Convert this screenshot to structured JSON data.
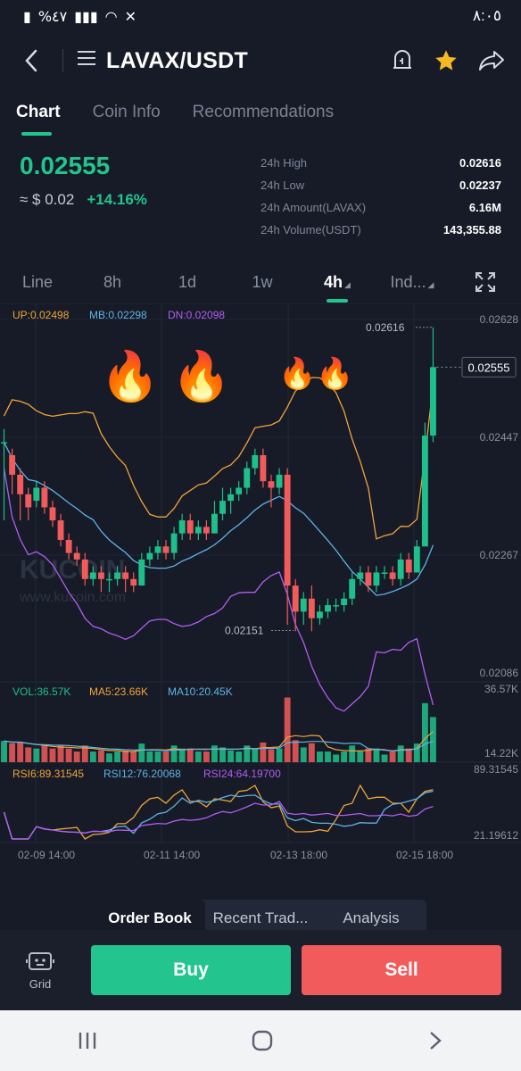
{
  "status_bar": {
    "left": "%٤٧",
    "time": "٨:٠٥"
  },
  "nav": {
    "pair": "LAVAX/USDT"
  },
  "tabs": [
    {
      "label": "Chart",
      "active": true
    },
    {
      "label": "Coin Info",
      "active": false
    },
    {
      "label": "Recommendations",
      "active": false
    }
  ],
  "price": {
    "last": "0.02555",
    "fiat": "≈ $ 0.02",
    "change": "+14.16%"
  },
  "stats": [
    {
      "label": "24h High",
      "value": "0.02616"
    },
    {
      "label": "24h Low",
      "value": "0.02237"
    },
    {
      "label": "24h Amount(LAVAX)",
      "value": "6.16M"
    },
    {
      "label": "24h Volume(USDT)",
      "value": "143,355.88"
    }
  ],
  "intervals": [
    {
      "label": "Line",
      "active": false,
      "dropdown": false
    },
    {
      "label": "8h",
      "active": false,
      "dropdown": false
    },
    {
      "label": "1d",
      "active": false,
      "dropdown": false
    },
    {
      "label": "1w",
      "active": false,
      "dropdown": false
    },
    {
      "label": "4h",
      "active": true,
      "dropdown": true
    },
    {
      "label": "Ind...",
      "active": false,
      "dropdown": true
    }
  ],
  "chart_data": {
    "type": "candlestick",
    "boll": {
      "up": "UP:0.02498",
      "mb": "MB:0.02298",
      "dn": "DN:0.02098"
    },
    "y_ticks": [
      "0.02628",
      "0.02447",
      "0.02267",
      "0.02086"
    ],
    "ylim": [
      0.02086,
      0.02628
    ],
    "current_price_label": "0.02555",
    "current_price": 0.02555,
    "high_marker": "0.02616",
    "high_value": 0.02616,
    "low_marker": "0.02151",
    "low_value": 0.02151,
    "watermark": {
      "brand": "KUCOIN",
      "url": "www.kucoin.com"
    },
    "candles": [
      [
        0.0244,
        0.0244,
        0.0246,
        0.0232
      ],
      [
        0.0242,
        0.0239,
        0.0243,
        0.0236
      ],
      [
        0.0239,
        0.0236,
        0.024,
        0.0232
      ],
      [
        0.0236,
        0.0234,
        0.0237,
        0.0232
      ],
      [
        0.0235,
        0.0237,
        0.0238,
        0.0234
      ],
      [
        0.0237,
        0.0234,
        0.0238,
        0.0233
      ],
      [
        0.0234,
        0.0232,
        0.0235,
        0.0231
      ],
      [
        0.0232,
        0.0229,
        0.0233,
        0.0228
      ],
      [
        0.0229,
        0.0227,
        0.023,
        0.0226
      ],
      [
        0.0227,
        0.0226,
        0.0228,
        0.0225
      ],
      [
        0.0226,
        0.0223,
        0.0227,
        0.0222
      ],
      [
        0.0223,
        0.0224,
        0.0225,
        0.0222
      ],
      [
        0.0224,
        0.0223,
        0.0225,
        0.0221
      ],
      [
        0.0223,
        0.0223,
        0.0224,
        0.0221
      ],
      [
        0.0223,
        0.0224,
        0.0225,
        0.0222
      ],
      [
        0.0224,
        0.0223,
        0.0225,
        0.0221
      ],
      [
        0.0223,
        0.0222,
        0.0224,
        0.0221
      ],
      [
        0.0222,
        0.0226,
        0.0227,
        0.0222
      ],
      [
        0.0226,
        0.0227,
        0.0228,
        0.0225
      ],
      [
        0.0227,
        0.0228,
        0.0229,
        0.0226
      ],
      [
        0.0228,
        0.0227,
        0.0229,
        0.0226
      ],
      [
        0.0227,
        0.023,
        0.0231,
        0.0226
      ],
      [
        0.023,
        0.0232,
        0.0233,
        0.0229
      ],
      [
        0.0232,
        0.023,
        0.0233,
        0.0229
      ],
      [
        0.023,
        0.0231,
        0.0232,
        0.0229
      ],
      [
        0.0231,
        0.023,
        0.0232,
        0.0229
      ],
      [
        0.023,
        0.0233,
        0.0235,
        0.023
      ],
      [
        0.0233,
        0.0235,
        0.0237,
        0.0232
      ],
      [
        0.0235,
        0.0236,
        0.0237,
        0.0233
      ],
      [
        0.0236,
        0.0237,
        0.0238,
        0.0235
      ],
      [
        0.0237,
        0.024,
        0.0241,
        0.0236
      ],
      [
        0.024,
        0.0242,
        0.0243,
        0.0239
      ],
      [
        0.0242,
        0.0238,
        0.0243,
        0.0237
      ],
      [
        0.0238,
        0.0237,
        0.0239,
        0.0234
      ],
      [
        0.0237,
        0.0239,
        0.024,
        0.0236
      ],
      [
        0.0239,
        0.0222,
        0.024,
        0.0216
      ],
      [
        0.0222,
        0.0218,
        0.0223,
        0.0215
      ],
      [
        0.0218,
        0.022,
        0.0221,
        0.0216
      ],
      [
        0.022,
        0.0217,
        0.0222,
        0.0215
      ],
      [
        0.0217,
        0.0218,
        0.0219,
        0.0216
      ],
      [
        0.0218,
        0.0219,
        0.022,
        0.0217
      ],
      [
        0.0219,
        0.0219,
        0.022,
        0.0218
      ],
      [
        0.0219,
        0.022,
        0.0221,
        0.0218
      ],
      [
        0.022,
        0.0223,
        0.0224,
        0.0219
      ],
      [
        0.0223,
        0.0224,
        0.0225,
        0.0222
      ],
      [
        0.0224,
        0.0222,
        0.0225,
        0.0221
      ],
      [
        0.0222,
        0.0224,
        0.0225,
        0.0221
      ],
      [
        0.0224,
        0.0224,
        0.0225,
        0.0223
      ],
      [
        0.0224,
        0.0223,
        0.0225,
        0.0222
      ],
      [
        0.0223,
        0.0226,
        0.0227,
        0.0222
      ],
      [
        0.0226,
        0.0224,
        0.0227,
        0.0223
      ],
      [
        0.0224,
        0.0228,
        0.0229,
        0.0224
      ],
      [
        0.0228,
        0.0245,
        0.0247,
        0.0228
      ],
      [
        0.0245,
        0.02555,
        0.02616,
        0.0244
      ]
    ],
    "vol_labels": {
      "vol": "VOL:36.57K",
      "ma5": "MA5:23.66K",
      "ma10": "MA10:20.45K"
    },
    "vol_ticks": [
      "36.57K",
      "14.22K"
    ],
    "rsi_labels": {
      "rsi6": "RSI6:89.31545",
      "rsi12": "RSI12:76.20068",
      "rsi24": "RSI24:64.19700"
    },
    "rsi_ticks": [
      "89.31545",
      "21.19612"
    ],
    "x_labels": [
      "02-09 14:00",
      "02-11 14:00",
      "02-13 18:00",
      "02-15 18:00"
    ],
    "colors": {
      "up": "#1fbf8b",
      "down": "#f25b5b",
      "boll_up": "#f0a43a",
      "boll_mb": "#5fb3e6",
      "boll_dn": "#b35cf5"
    }
  },
  "order_tabs": [
    {
      "label": "Order Book",
      "active": true
    },
    {
      "label": "Recent Trad...",
      "active": false
    },
    {
      "label": "Analysis",
      "active": false
    }
  ],
  "actions": {
    "grid": "Grid",
    "buy": "Buy",
    "sell": "Sell"
  }
}
